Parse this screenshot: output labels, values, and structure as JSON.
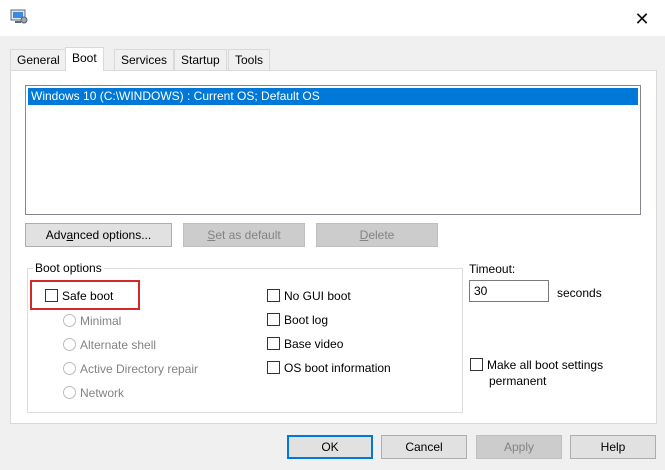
{
  "window": {
    "close_symbol": "✕"
  },
  "tabs": [
    {
      "label": "General"
    },
    {
      "label": "Boot",
      "active": true
    },
    {
      "label": "Services"
    },
    {
      "label": "Startup"
    },
    {
      "label": "Tools"
    }
  ],
  "os_list": {
    "items": [
      "Windows 10 (C:\\WINDOWS) : Current OS; Default OS"
    ]
  },
  "os_buttons": {
    "advanced": "Advanced options...",
    "set_default": "Set as default",
    "delete": "Delete"
  },
  "boot_options": {
    "title": "Boot options",
    "safe_boot": "Safe boot",
    "minimal": "Minimal",
    "alternate_shell": "Alternate shell",
    "ad_repair": "Active Directory repair",
    "network": "Network",
    "no_gui_boot": "No GUI boot",
    "boot_log": "Boot log",
    "base_video": "Base video",
    "os_boot_info": "OS boot information"
  },
  "timeout": {
    "label": "Timeout:",
    "value": "30",
    "unit": "seconds"
  },
  "permanent": {
    "line1": "Make all boot settings",
    "line2": "permanent"
  },
  "footer": {
    "ok": "OK",
    "cancel": "Cancel",
    "apply": "Apply",
    "help": "Help"
  },
  "colors": {
    "selection": "#0078d7",
    "highlight_box": "#d22a2a"
  },
  "icons": {
    "app": "msconfig-icon",
    "close": "close-icon"
  }
}
